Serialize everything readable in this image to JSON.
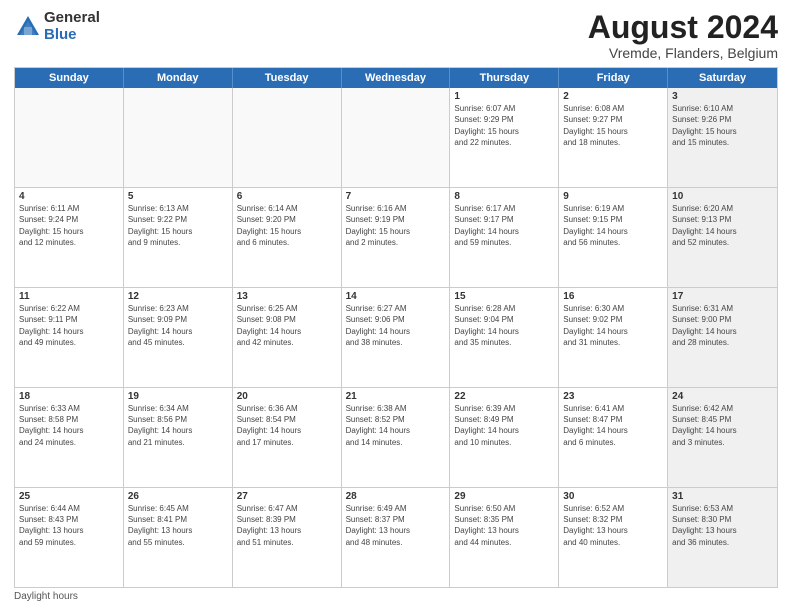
{
  "header": {
    "logo_general": "General",
    "logo_blue": "Blue",
    "main_title": "August 2024",
    "subtitle": "Vremde, Flanders, Belgium"
  },
  "days_of_week": [
    "Sunday",
    "Monday",
    "Tuesday",
    "Wednesday",
    "Thursday",
    "Friday",
    "Saturday"
  ],
  "footer": {
    "note": "Daylight hours"
  },
  "weeks": [
    [
      {
        "day": "",
        "info": "",
        "empty": true
      },
      {
        "day": "",
        "info": "",
        "empty": true
      },
      {
        "day": "",
        "info": "",
        "empty": true
      },
      {
        "day": "",
        "info": "",
        "empty": true
      },
      {
        "day": "1",
        "info": "Sunrise: 6:07 AM\nSunset: 9:29 PM\nDaylight: 15 hours\nand 22 minutes.",
        "empty": false
      },
      {
        "day": "2",
        "info": "Sunrise: 6:08 AM\nSunset: 9:27 PM\nDaylight: 15 hours\nand 18 minutes.",
        "empty": false
      },
      {
        "day": "3",
        "info": "Sunrise: 6:10 AM\nSunset: 9:26 PM\nDaylight: 15 hours\nand 15 minutes.",
        "empty": false,
        "shaded": true
      }
    ],
    [
      {
        "day": "4",
        "info": "Sunrise: 6:11 AM\nSunset: 9:24 PM\nDaylight: 15 hours\nand 12 minutes.",
        "empty": false
      },
      {
        "day": "5",
        "info": "Sunrise: 6:13 AM\nSunset: 9:22 PM\nDaylight: 15 hours\nand 9 minutes.",
        "empty": false
      },
      {
        "day": "6",
        "info": "Sunrise: 6:14 AM\nSunset: 9:20 PM\nDaylight: 15 hours\nand 6 minutes.",
        "empty": false
      },
      {
        "day": "7",
        "info": "Sunrise: 6:16 AM\nSunset: 9:19 PM\nDaylight: 15 hours\nand 2 minutes.",
        "empty": false
      },
      {
        "day": "8",
        "info": "Sunrise: 6:17 AM\nSunset: 9:17 PM\nDaylight: 14 hours\nand 59 minutes.",
        "empty": false
      },
      {
        "day": "9",
        "info": "Sunrise: 6:19 AM\nSunset: 9:15 PM\nDaylight: 14 hours\nand 56 minutes.",
        "empty": false
      },
      {
        "day": "10",
        "info": "Sunrise: 6:20 AM\nSunset: 9:13 PM\nDaylight: 14 hours\nand 52 minutes.",
        "empty": false,
        "shaded": true
      }
    ],
    [
      {
        "day": "11",
        "info": "Sunrise: 6:22 AM\nSunset: 9:11 PM\nDaylight: 14 hours\nand 49 minutes.",
        "empty": false
      },
      {
        "day": "12",
        "info": "Sunrise: 6:23 AM\nSunset: 9:09 PM\nDaylight: 14 hours\nand 45 minutes.",
        "empty": false
      },
      {
        "day": "13",
        "info": "Sunrise: 6:25 AM\nSunset: 9:08 PM\nDaylight: 14 hours\nand 42 minutes.",
        "empty": false
      },
      {
        "day": "14",
        "info": "Sunrise: 6:27 AM\nSunset: 9:06 PM\nDaylight: 14 hours\nand 38 minutes.",
        "empty": false
      },
      {
        "day": "15",
        "info": "Sunrise: 6:28 AM\nSunset: 9:04 PM\nDaylight: 14 hours\nand 35 minutes.",
        "empty": false
      },
      {
        "day": "16",
        "info": "Sunrise: 6:30 AM\nSunset: 9:02 PM\nDaylight: 14 hours\nand 31 minutes.",
        "empty": false
      },
      {
        "day": "17",
        "info": "Sunrise: 6:31 AM\nSunset: 9:00 PM\nDaylight: 14 hours\nand 28 minutes.",
        "empty": false,
        "shaded": true
      }
    ],
    [
      {
        "day": "18",
        "info": "Sunrise: 6:33 AM\nSunset: 8:58 PM\nDaylight: 14 hours\nand 24 minutes.",
        "empty": false
      },
      {
        "day": "19",
        "info": "Sunrise: 6:34 AM\nSunset: 8:56 PM\nDaylight: 14 hours\nand 21 minutes.",
        "empty": false
      },
      {
        "day": "20",
        "info": "Sunrise: 6:36 AM\nSunset: 8:54 PM\nDaylight: 14 hours\nand 17 minutes.",
        "empty": false
      },
      {
        "day": "21",
        "info": "Sunrise: 6:38 AM\nSunset: 8:52 PM\nDaylight: 14 hours\nand 14 minutes.",
        "empty": false
      },
      {
        "day": "22",
        "info": "Sunrise: 6:39 AM\nSunset: 8:49 PM\nDaylight: 14 hours\nand 10 minutes.",
        "empty": false
      },
      {
        "day": "23",
        "info": "Sunrise: 6:41 AM\nSunset: 8:47 PM\nDaylight: 14 hours\nand 6 minutes.",
        "empty": false
      },
      {
        "day": "24",
        "info": "Sunrise: 6:42 AM\nSunset: 8:45 PM\nDaylight: 14 hours\nand 3 minutes.",
        "empty": false,
        "shaded": true
      }
    ],
    [
      {
        "day": "25",
        "info": "Sunrise: 6:44 AM\nSunset: 8:43 PM\nDaylight: 13 hours\nand 59 minutes.",
        "empty": false
      },
      {
        "day": "26",
        "info": "Sunrise: 6:45 AM\nSunset: 8:41 PM\nDaylight: 13 hours\nand 55 minutes.",
        "empty": false
      },
      {
        "day": "27",
        "info": "Sunrise: 6:47 AM\nSunset: 8:39 PM\nDaylight: 13 hours\nand 51 minutes.",
        "empty": false
      },
      {
        "day": "28",
        "info": "Sunrise: 6:49 AM\nSunset: 8:37 PM\nDaylight: 13 hours\nand 48 minutes.",
        "empty": false
      },
      {
        "day": "29",
        "info": "Sunrise: 6:50 AM\nSunset: 8:35 PM\nDaylight: 13 hours\nand 44 minutes.",
        "empty": false
      },
      {
        "day": "30",
        "info": "Sunrise: 6:52 AM\nSunset: 8:32 PM\nDaylight: 13 hours\nand 40 minutes.",
        "empty": false
      },
      {
        "day": "31",
        "info": "Sunrise: 6:53 AM\nSunset: 8:30 PM\nDaylight: 13 hours\nand 36 minutes.",
        "empty": false,
        "shaded": true
      }
    ]
  ]
}
